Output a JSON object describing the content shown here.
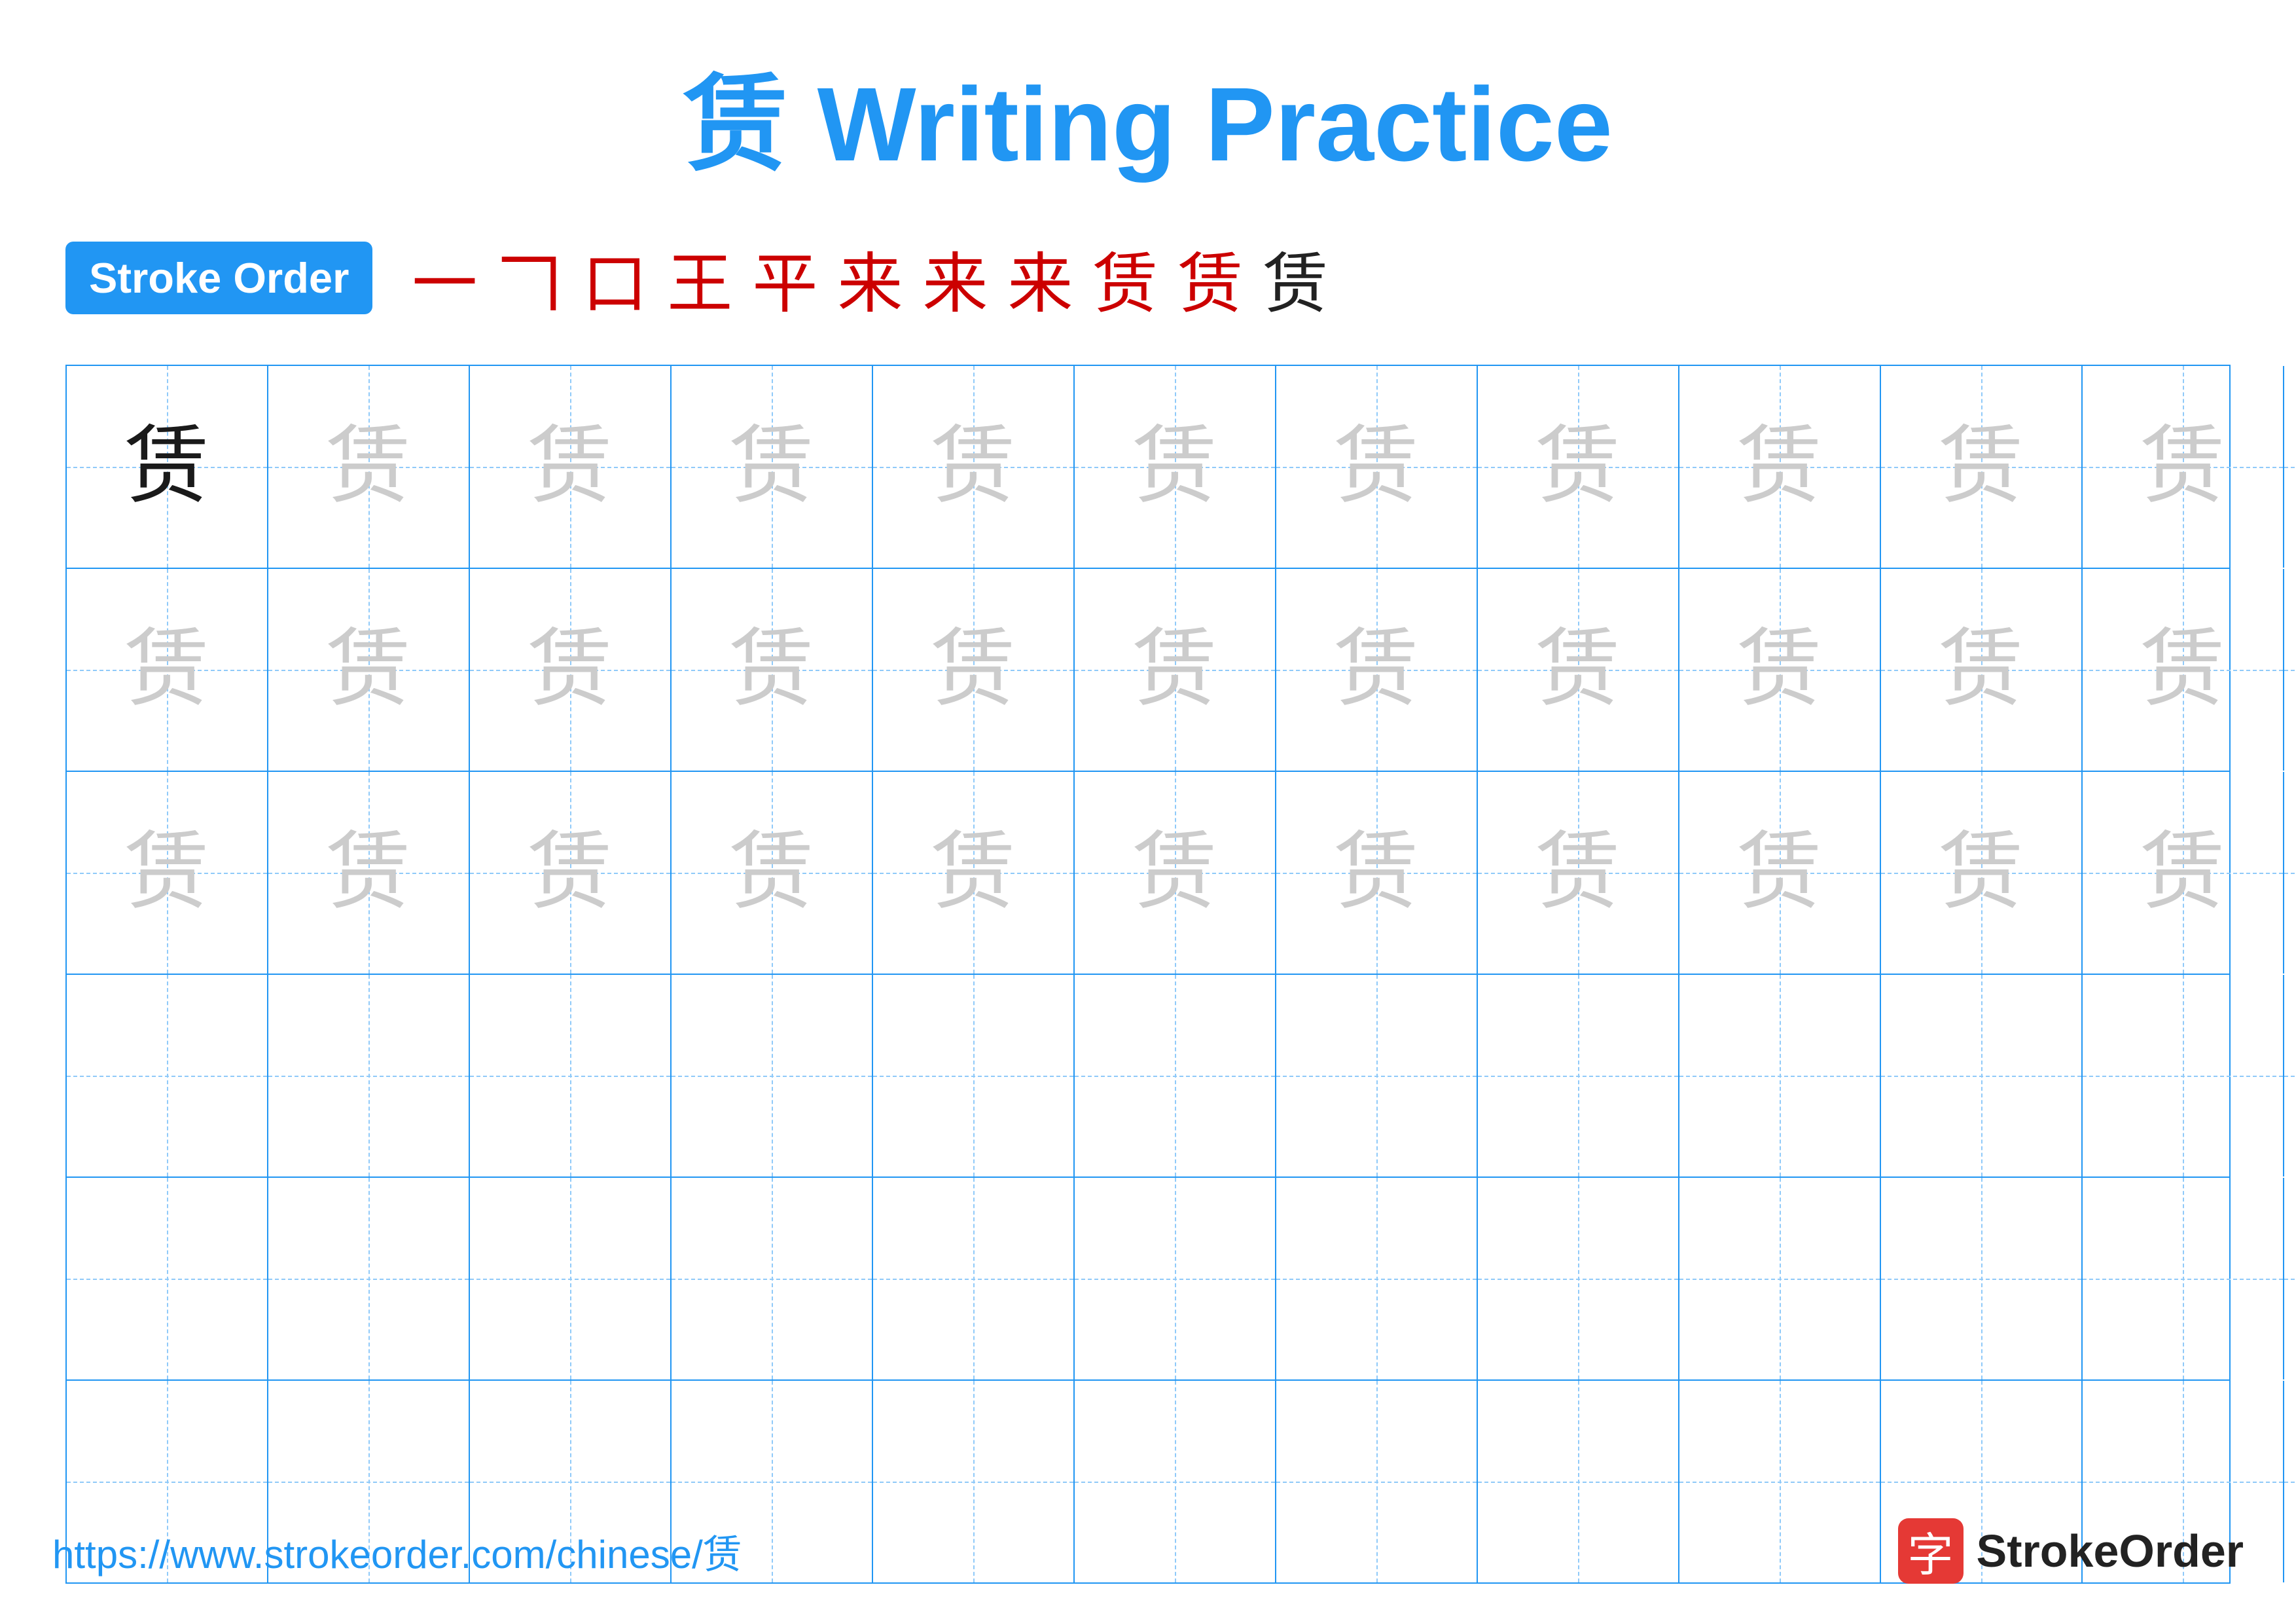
{
  "title": "赁 Writing Practice",
  "stroke_order": {
    "badge_label": "Stroke Order",
    "strokes": [
      {
        "char": "一",
        "color": "red"
      },
      {
        "char": "𠃍",
        "color": "red"
      },
      {
        "char": "口",
        "color": "red"
      },
      {
        "char": "王",
        "color": "red"
      },
      {
        "char": "平",
        "color": "red"
      },
      {
        "char": "来",
        "color": "red"
      },
      {
        "char": "来",
        "color": "red"
      },
      {
        "char": "来",
        "color": "red"
      },
      {
        "char": "赁",
        "color": "red"
      },
      {
        "char": "赁",
        "color": "red"
      },
      {
        "char": "赁",
        "color": "black"
      }
    ]
  },
  "character": "赁",
  "grid": {
    "rows": 6,
    "cols": 13,
    "filled_rows": 3,
    "first_cell_dark": true
  },
  "footer": {
    "url": "https://www.strokeorder.com/chinese/赁",
    "logo_text": "StrokeOrder",
    "logo_icon": "字"
  }
}
